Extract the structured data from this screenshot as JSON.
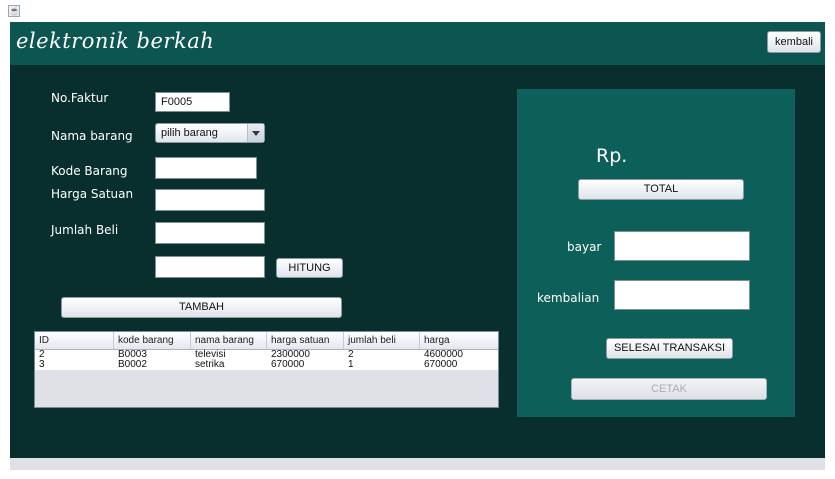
{
  "window": {
    "icon": "java-app-icon"
  },
  "header": {
    "title": "elektronik berkah",
    "back_button": "kembali"
  },
  "form": {
    "no_faktur": {
      "label": "No.Faktur",
      "value": "F0005"
    },
    "nama_barang": {
      "label": "Nama barang",
      "selected": "pilih barang"
    },
    "kode_barang": {
      "label": "Kode Barang",
      "value": ""
    },
    "harga_satuan": {
      "label": "Harga Satuan",
      "value": ""
    },
    "jumlah_beli": {
      "label": "Jumlah Beli",
      "value": ""
    },
    "subtotal": {
      "value": ""
    },
    "hitung_button": "HITUNG",
    "tambah_button": "TAMBAH"
  },
  "table": {
    "columns": [
      "ID",
      "kode barang",
      "nama barang",
      "harga satuan",
      "jumlah beli",
      "harga"
    ],
    "rows": [
      [
        "2",
        "B0003",
        "televisi",
        "2300000",
        "2",
        "4600000"
      ],
      [
        "3",
        "B0002",
        "setrika",
        "670000",
        "1",
        "670000"
      ]
    ]
  },
  "payment": {
    "currency_label": "Rp.",
    "total_button": "TOTAL",
    "bayar_label": "bayar",
    "bayar_value": "",
    "kembalian_label": "kembalian",
    "kembalian_value": "",
    "selesai_button": "SELESAI TRANSAKSI",
    "cetak_button": "CETAK"
  },
  "colors": {
    "header": "#0d5550",
    "main": "#082f2d",
    "panel": "#0d5f5a",
    "frame": "#dfe1e7"
  }
}
